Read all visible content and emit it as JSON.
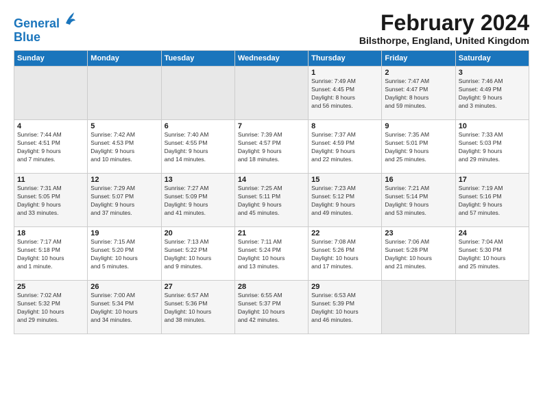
{
  "header": {
    "logo_line1": "General",
    "logo_line2": "Blue",
    "month_title": "February 2024",
    "location": "Bilsthorpe, England, United Kingdom"
  },
  "days_of_week": [
    "Sunday",
    "Monday",
    "Tuesday",
    "Wednesday",
    "Thursday",
    "Friday",
    "Saturday"
  ],
  "weeks": [
    [
      {
        "day": "",
        "info": ""
      },
      {
        "day": "",
        "info": ""
      },
      {
        "day": "",
        "info": ""
      },
      {
        "day": "",
        "info": ""
      },
      {
        "day": "1",
        "info": "Sunrise: 7:49 AM\nSunset: 4:45 PM\nDaylight: 8 hours\nand 56 minutes."
      },
      {
        "day": "2",
        "info": "Sunrise: 7:47 AM\nSunset: 4:47 PM\nDaylight: 8 hours\nand 59 minutes."
      },
      {
        "day": "3",
        "info": "Sunrise: 7:46 AM\nSunset: 4:49 PM\nDaylight: 9 hours\nand 3 minutes."
      }
    ],
    [
      {
        "day": "4",
        "info": "Sunrise: 7:44 AM\nSunset: 4:51 PM\nDaylight: 9 hours\nand 7 minutes."
      },
      {
        "day": "5",
        "info": "Sunrise: 7:42 AM\nSunset: 4:53 PM\nDaylight: 9 hours\nand 10 minutes."
      },
      {
        "day": "6",
        "info": "Sunrise: 7:40 AM\nSunset: 4:55 PM\nDaylight: 9 hours\nand 14 minutes."
      },
      {
        "day": "7",
        "info": "Sunrise: 7:39 AM\nSunset: 4:57 PM\nDaylight: 9 hours\nand 18 minutes."
      },
      {
        "day": "8",
        "info": "Sunrise: 7:37 AM\nSunset: 4:59 PM\nDaylight: 9 hours\nand 22 minutes."
      },
      {
        "day": "9",
        "info": "Sunrise: 7:35 AM\nSunset: 5:01 PM\nDaylight: 9 hours\nand 25 minutes."
      },
      {
        "day": "10",
        "info": "Sunrise: 7:33 AM\nSunset: 5:03 PM\nDaylight: 9 hours\nand 29 minutes."
      }
    ],
    [
      {
        "day": "11",
        "info": "Sunrise: 7:31 AM\nSunset: 5:05 PM\nDaylight: 9 hours\nand 33 minutes."
      },
      {
        "day": "12",
        "info": "Sunrise: 7:29 AM\nSunset: 5:07 PM\nDaylight: 9 hours\nand 37 minutes."
      },
      {
        "day": "13",
        "info": "Sunrise: 7:27 AM\nSunset: 5:09 PM\nDaylight: 9 hours\nand 41 minutes."
      },
      {
        "day": "14",
        "info": "Sunrise: 7:25 AM\nSunset: 5:11 PM\nDaylight: 9 hours\nand 45 minutes."
      },
      {
        "day": "15",
        "info": "Sunrise: 7:23 AM\nSunset: 5:12 PM\nDaylight: 9 hours\nand 49 minutes."
      },
      {
        "day": "16",
        "info": "Sunrise: 7:21 AM\nSunset: 5:14 PM\nDaylight: 9 hours\nand 53 minutes."
      },
      {
        "day": "17",
        "info": "Sunrise: 7:19 AM\nSunset: 5:16 PM\nDaylight: 9 hours\nand 57 minutes."
      }
    ],
    [
      {
        "day": "18",
        "info": "Sunrise: 7:17 AM\nSunset: 5:18 PM\nDaylight: 10 hours\nand 1 minute."
      },
      {
        "day": "19",
        "info": "Sunrise: 7:15 AM\nSunset: 5:20 PM\nDaylight: 10 hours\nand 5 minutes."
      },
      {
        "day": "20",
        "info": "Sunrise: 7:13 AM\nSunset: 5:22 PM\nDaylight: 10 hours\nand 9 minutes."
      },
      {
        "day": "21",
        "info": "Sunrise: 7:11 AM\nSunset: 5:24 PM\nDaylight: 10 hours\nand 13 minutes."
      },
      {
        "day": "22",
        "info": "Sunrise: 7:08 AM\nSunset: 5:26 PM\nDaylight: 10 hours\nand 17 minutes."
      },
      {
        "day": "23",
        "info": "Sunrise: 7:06 AM\nSunset: 5:28 PM\nDaylight: 10 hours\nand 21 minutes."
      },
      {
        "day": "24",
        "info": "Sunrise: 7:04 AM\nSunset: 5:30 PM\nDaylight: 10 hours\nand 25 minutes."
      }
    ],
    [
      {
        "day": "25",
        "info": "Sunrise: 7:02 AM\nSunset: 5:32 PM\nDaylight: 10 hours\nand 29 minutes."
      },
      {
        "day": "26",
        "info": "Sunrise: 7:00 AM\nSunset: 5:34 PM\nDaylight: 10 hours\nand 34 minutes."
      },
      {
        "day": "27",
        "info": "Sunrise: 6:57 AM\nSunset: 5:36 PM\nDaylight: 10 hours\nand 38 minutes."
      },
      {
        "day": "28",
        "info": "Sunrise: 6:55 AM\nSunset: 5:37 PM\nDaylight: 10 hours\nand 42 minutes."
      },
      {
        "day": "29",
        "info": "Sunrise: 6:53 AM\nSunset: 5:39 PM\nDaylight: 10 hours\nand 46 minutes."
      },
      {
        "day": "",
        "info": ""
      },
      {
        "day": "",
        "info": ""
      }
    ]
  ]
}
